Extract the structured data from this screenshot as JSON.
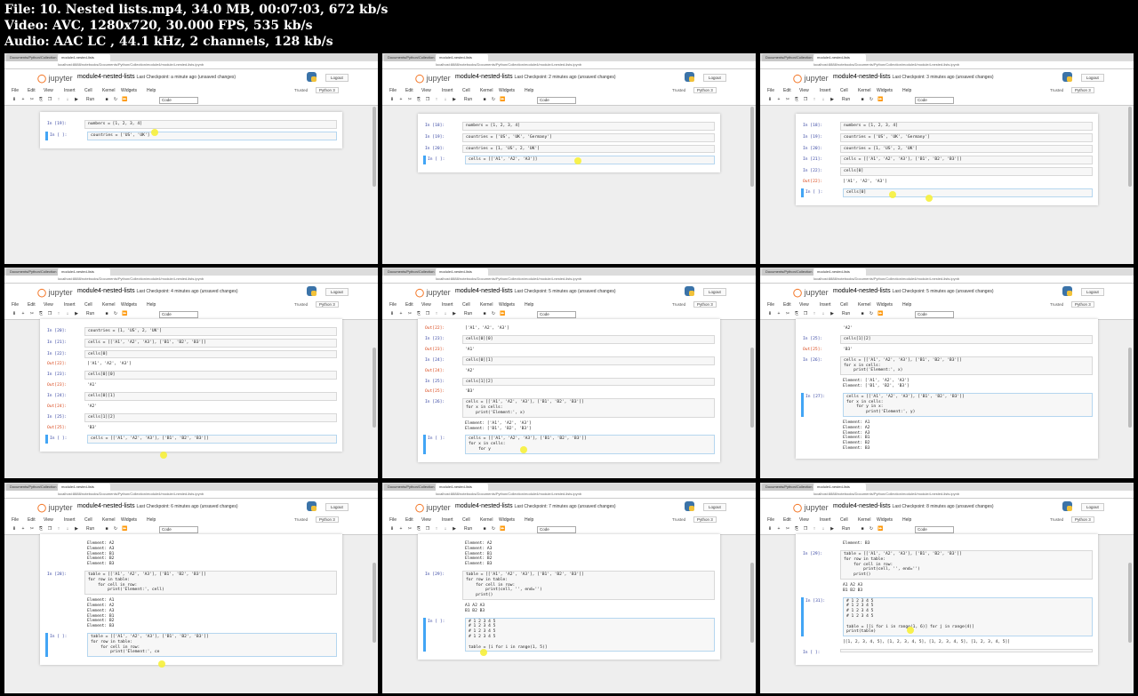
{
  "file_info": {
    "line1": "File: 10. Nested lists.mp4, 34.0 MB, 00:07:03, 672 kb/s",
    "line2": "Video: AVC, 1280x720, 30.000 FPS, 535 kb/s",
    "line3": "Audio: AAC LC , 44.1 kHz, 2 channels, 128 kb/s"
  },
  "common": {
    "logo": "jupyter",
    "notebook": "module4-nested-lists",
    "tab1": "Documents/Python/Collection",
    "tab2": "module4-nested-lists",
    "address": "localhost:8888/notebooks/Documents/Python/Collection/module4/module4-nested-lists.ipynb",
    "logout": "Logout",
    "trusted": "Trusted",
    "kernel": "Python 3",
    "menu": [
      "File",
      "Edit",
      "View",
      "Insert",
      "Cell",
      "Kernel",
      "Widgets",
      "Help"
    ],
    "run": "Run",
    "cell_type": "Code"
  },
  "thumbs": [
    {
      "checkpoint": "Last Checkpoint: a minute ago",
      "status": "(unsaved changes)",
      "cells": [
        {
          "k": "in",
          "p": "In [19]:",
          "t": "numbers = [1, 2, 3, 4]"
        },
        {
          "k": "in",
          "p": "In [ ]:",
          "t": "countries = ['US', 'UK']",
          "sel": true
        }
      ]
    },
    {
      "checkpoint": "Last Checkpoint: 2 minutes ago",
      "status": "(unsaved changes)",
      "cells": [
        {
          "k": "in",
          "p": "In [18]:",
          "t": "numbers = [1, 2, 3, 4]"
        },
        {
          "k": "in",
          "p": "In [19]:",
          "t": "countries = ['US', 'UK', 'Germany']"
        },
        {
          "k": "in",
          "p": "In [20]:",
          "t": "countries = [1, 'US', 2, 'UK']"
        },
        {
          "k": "in",
          "p": "In [ ]:",
          "t": "cells = [['A1', 'A2', 'A3']]",
          "sel": true
        }
      ]
    },
    {
      "checkpoint": "Last Checkpoint: 3 minutes ago",
      "status": "(unsaved changes)",
      "cells": [
        {
          "k": "in",
          "p": "In [18]:",
          "t": "numbers = [1, 2, 3, 4]"
        },
        {
          "k": "in",
          "p": "In [19]:",
          "t": "countries = ['US', 'UK', 'Germany']"
        },
        {
          "k": "in",
          "p": "In [20]:",
          "t": "countries = [1, 'US', 2, 'UK']"
        },
        {
          "k": "in",
          "p": "In [21]:",
          "t": "cells = [['A1', 'A2', 'A3'], ['B1', 'B2', 'B3']]"
        },
        {
          "k": "in",
          "p": "In [22]:",
          "t": "cells[0]"
        },
        {
          "k": "out",
          "p": "Out[22]:",
          "t": "['A1', 'A2', 'A3']"
        },
        {
          "k": "in",
          "p": "In [ ]:",
          "t": "cells[0]",
          "sel": true
        }
      ]
    },
    {
      "checkpoint": "Last Checkpoint: 4 minutes ago",
      "status": "(unsaved changes)",
      "cells": [
        {
          "k": "in",
          "p": "In [20]:",
          "t": "countries = [1, 'US', 2, 'UK']"
        },
        {
          "k": "in",
          "p": "In [21]:",
          "t": "cells = [['A1', 'A2', 'A3'], ['B1', 'B2', 'B3']]"
        },
        {
          "k": "in",
          "p": "In [22]:",
          "t": "cells[0]"
        },
        {
          "k": "out",
          "p": "Out[22]:",
          "t": "['A1', 'A2', 'A3']"
        },
        {
          "k": "in",
          "p": "In [23]:",
          "t": "cells[0][0]"
        },
        {
          "k": "out",
          "p": "Out[23]:",
          "t": "'A1'"
        },
        {
          "k": "in",
          "p": "In [24]:",
          "t": "cells[0][1]"
        },
        {
          "k": "out",
          "p": "Out[24]:",
          "t": "'A2'"
        },
        {
          "k": "in",
          "p": "In [25]:",
          "t": "cells[1][2]"
        },
        {
          "k": "out",
          "p": "Out[25]:",
          "t": "'B3'"
        },
        {
          "k": "in",
          "p": "In [ ]:",
          "t": "cells = [['A1', 'A2', 'A3'], ['B1', 'B2', 'B3']]\n",
          "sel": true
        }
      ]
    },
    {
      "checkpoint": "Last Checkpoint: 5 minutes ago",
      "status": "(unsaved changes)",
      "cells": [
        {
          "k": "out",
          "p": "Out[22]:",
          "t": "['A1', 'A2', 'A3']"
        },
        {
          "k": "in",
          "p": "In [23]:",
          "t": "cells[0][0]"
        },
        {
          "k": "out",
          "p": "Out[23]:",
          "t": "'A1'"
        },
        {
          "k": "in",
          "p": "In [24]:",
          "t": "cells[0][1]"
        },
        {
          "k": "out",
          "p": "Out[24]:",
          "t": "'A2'"
        },
        {
          "k": "in",
          "p": "In [25]:",
          "t": "cells[1][2]"
        },
        {
          "k": "out",
          "p": "Out[25]:",
          "t": "'B3'"
        },
        {
          "k": "in",
          "p": "In [26]:",
          "t": "cells = [['A1', 'A2', 'A3'], ['B1', 'B2', 'B3']]\nfor x in cells:\n    print('Element:', x)"
        },
        {
          "k": "out",
          "p": "",
          "t": "Element: ['A1', 'A2', 'A3']\nElement: ['B1', 'B2', 'B3']"
        },
        {
          "k": "in",
          "p": "In [ ]:",
          "t": "cells = [['A1', 'A2', 'A3'], ['B1', 'B2', 'B3']]\nfor x in cells:\n    for y",
          "sel": true
        }
      ]
    },
    {
      "checkpoint": "Last Checkpoint: 5 minutes ago",
      "status": "(unsaved changes)",
      "cells": [
        {
          "k": "out",
          "p": "",
          "t": "'A2'"
        },
        {
          "k": "in",
          "p": "In [25]:",
          "t": "cells[1][2]"
        },
        {
          "k": "out",
          "p": "Out[25]:",
          "t": "'B3'"
        },
        {
          "k": "in",
          "p": "In [26]:",
          "t": "cells = [['A1', 'A2', 'A3'], ['B1', 'B2', 'B3']]\nfor x in cells:\n    print('Element:', x)"
        },
        {
          "k": "out",
          "p": "",
          "t": "Element: ['A1', 'A2', 'A3']\nElement: ['B1', 'B2', 'B3']"
        },
        {
          "k": "in",
          "p": "In [27]:",
          "t": "cells = [['A1', 'A2', 'A3'], ['B1', 'B2', 'B3']]\nfor x in cells:\n    for y in x:\n        print('Element:', y)",
          "sel": true
        },
        {
          "k": "out",
          "p": "",
          "t": "Element: A1\nElement: A2\nElement: A3\nElement: B1\nElement: B2\nElement: B3"
        }
      ]
    },
    {
      "checkpoint": "Last Checkpoint: 6 minutes ago",
      "status": "(unsaved changes)",
      "cells": [
        {
          "k": "out",
          "p": "",
          "t": "Element: A2\nElement: A3\nElement: B1\nElement: B2\nElement: B3"
        },
        {
          "k": "in",
          "p": "In [28]:",
          "t": "table = [['A1', 'A2', 'A3'], ['B1', 'B2', 'B3']]\nfor row in table:\n    for cell in row:\n        print('Element:', cell)"
        },
        {
          "k": "out",
          "p": "",
          "t": "Element: A1\nElement: A2\nElement: A3\nElement: B1\nElement: B2\nElement: B3"
        },
        {
          "k": "in",
          "p": "In [ ]:",
          "t": "table = [['A1', 'A2', 'A3'], ['B1', 'B2', 'B3']]\nfor row in table:\n    for cell in row:\n        print('Element:', ce",
          "sel": true
        }
      ]
    },
    {
      "checkpoint": "Last Checkpoint: 7 minutes ago",
      "status": "(unsaved changes)",
      "cells": [
        {
          "k": "out",
          "p": "",
          "t": "Element: A2\nElement: A3\nElement: B1\nElement: B2\nElement: B3"
        },
        {
          "k": "in",
          "p": "In [29]:",
          "t": "table = [['A1', 'A2', 'A3'], ['B1', 'B2', 'B3']]\nfor row in table:\n    for cell in row:\n        print(cell, '', end='')\n    print()"
        },
        {
          "k": "out",
          "p": "",
          "t": "A1 A2 A3\nB1 B2 B3"
        },
        {
          "k": "in",
          "p": "In [ ]:",
          "t": "# 1 2 3 4 5\n# 1 2 3 4 5\n# 1 2 3 4 5\n# 1 2 3 4 5\n\ntable = [i for i in range(1, 5)]\n",
          "sel": true
        }
      ]
    },
    {
      "checkpoint": "Last Checkpoint: 8 minutes ago",
      "status": "(unsaved changes)",
      "cells": [
        {
          "k": "out",
          "p": "",
          "t": "Element: B3"
        },
        {
          "k": "in",
          "p": "In [29]:",
          "t": "table = [['A1', 'A2', 'A3'], ['B1', 'B2', 'B3']]\nfor row in table:\n    for cell in row:\n        print(cell, '', end='')\n    print()"
        },
        {
          "k": "out",
          "p": "",
          "t": "A1 A2 A3\nB1 B2 B3"
        },
        {
          "k": "in",
          "p": "In [31]:",
          "t": "# 1 2 3 4 5\n# 1 2 3 4 5\n# 1 2 3 4 5\n# 1 2 3 4 5\n\ntable = [[i for i in range(1, 6)] for j in range(4)]\nprint(table)",
          "sel": true
        },
        {
          "k": "out",
          "p": "",
          "t": "[[1, 2, 3, 4, 5], [1, 2, 3, 4, 5], [1, 2, 3, 4, 5], [1, 2, 3, 4, 5]]"
        },
        {
          "k": "in",
          "p": "In [ ]:",
          "t": ""
        }
      ]
    }
  ]
}
